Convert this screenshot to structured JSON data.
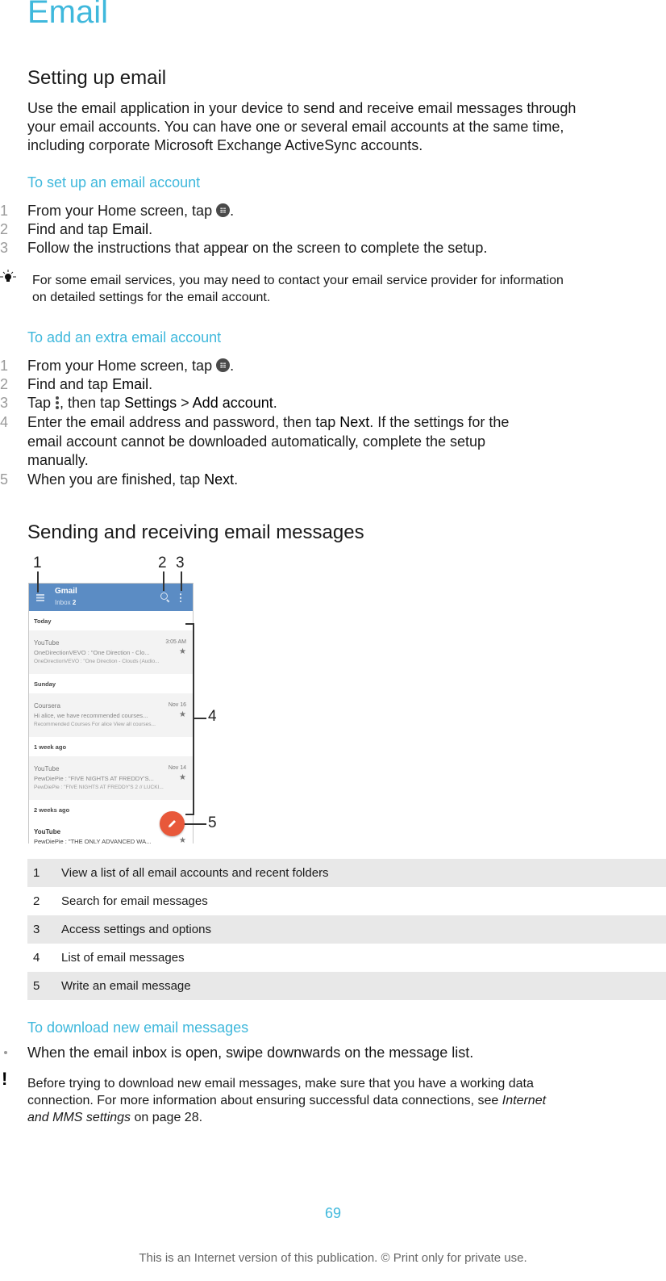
{
  "title": "Email",
  "section1": {
    "heading": "Setting up email",
    "intro_lines": [
      "Use the email application in your device to send and receive email messages through",
      "your email accounts. You can have one or several email accounts at the same time,",
      "including corporate Microsoft Exchange ActiveSync accounts."
    ],
    "setup": {
      "heading": "To set up an email account",
      "steps": [
        {
          "num": "1",
          "pre": "From your Home screen, tap ",
          "icon": "apps-icon",
          "post": "."
        },
        {
          "num": "2",
          "pre": "Find and tap ",
          "ui": "Email",
          "post": "."
        },
        {
          "num": "3",
          "pre": "Follow the instructions that appear on the screen to complete the setup."
        }
      ],
      "tip_icon": "lightbulb-icon",
      "tip_lines": [
        "For some email services, you may need to contact your email service provider for information",
        "on detailed settings for the email account."
      ]
    },
    "add": {
      "heading": "To add an extra email account",
      "steps": [
        {
          "num": "1",
          "pre": "From your Home screen, tap ",
          "icon": "apps-icon",
          "post": "."
        },
        {
          "num": "2",
          "pre": "Find and tap ",
          "ui": "Email",
          "post": "."
        },
        {
          "num": "3",
          "pre": "Tap ",
          "icon": "more-vert-icon",
          "mid": ", then tap ",
          "ui": "Settings",
          "sep": " > ",
          "ui2": "Add account",
          "post": "."
        },
        {
          "num": "4",
          "pre": "Enter the email address and password, then tap ",
          "ui": "Next",
          "post": ". If the settings for the",
          "cont": [
            "email account cannot be downloaded automatically, complete the setup",
            "manually."
          ]
        },
        {
          "num": "5",
          "pre": "When you are finished, tap ",
          "ui": "Next",
          "post": "."
        }
      ]
    }
  },
  "section2": {
    "heading": "Sending and receiving email messages",
    "screenshot": {
      "app_name": "Gmail",
      "inbox_label": "Inbox",
      "inbox_count": "2",
      "groups": [
        {
          "label": "Today",
          "mail": {
            "from": "YouTube",
            "date": "3:05 AM",
            "subject": "OneDirectionVEVO : \"One Direction - Clo...",
            "snippet": "OneDirectionVEVO : \"One Direction - Clouds (Audio..."
          }
        },
        {
          "label": "Sunday",
          "mail": {
            "from": "Coursera",
            "date": "Nov 16",
            "subject": "Hi alice, we have recommended courses...",
            "snippet": "Recommended Courses For alice View all courses..."
          }
        },
        {
          "label": "1 week ago",
          "mail": {
            "from": "YouTube",
            "date": "Nov 14",
            "subject": "PewDiePie : \"FIVE NIGHTS AT FREDDY'S...",
            "snippet": "PewDiePie : \"FIVE NIGHTS AT FREDDY'S 2 // LUCKI..."
          }
        },
        {
          "label": "2 weeks ago",
          "mail": {
            "from": "YouTube",
            "date": "",
            "subject": "PewDiePie : \"THE ONLY ADVANCED WA...",
            "snippet": ""
          }
        }
      ],
      "star": "★",
      "callouts": [
        "1",
        "2",
        "3",
        "4",
        "5"
      ]
    },
    "legend": [
      {
        "num": "1",
        "text": "View a list of all email accounts and recent folders"
      },
      {
        "num": "2",
        "text": "Search for email messages"
      },
      {
        "num": "3",
        "text": "Access settings and options"
      },
      {
        "num": "4",
        "text": "List of email messages"
      },
      {
        "num": "5",
        "text": "Write an email message"
      }
    ],
    "download": {
      "heading": "To download new email messages",
      "bullet": "When the email inbox is open, swipe downwards on the message list.",
      "warn_icon": "!",
      "warn_lines": [
        "Before trying to download new email messages, make sure that you have a working data",
        "connection. For more information about ensuring successful data connections, see "
      ],
      "warn_link_part1": "Internet",
      "warn_link_part2": "and MMS settings",
      "warn_tail": " on page 28."
    }
  },
  "page_number": "69",
  "footer": "This is an Internet version of this publication. © Print only for private use.",
  "colors": {
    "accent": "#3fb8dc",
    "appbar": "#5b8cc4",
    "fab": "#e8583a"
  }
}
